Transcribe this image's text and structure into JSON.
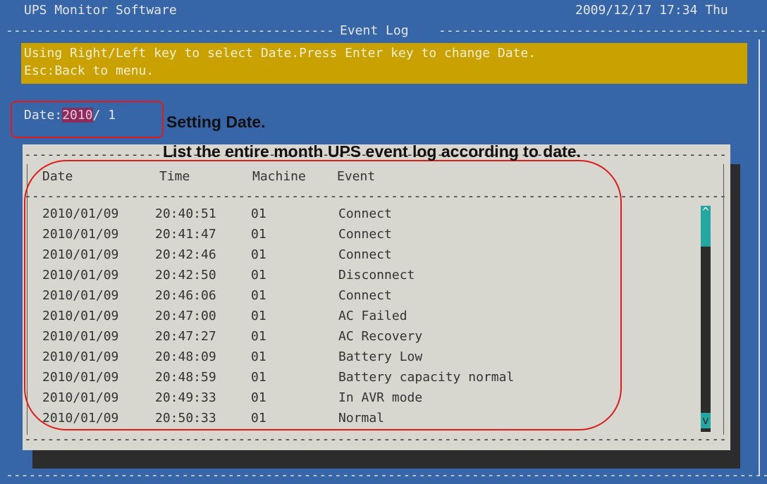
{
  "header": {
    "app_title": "UPS Monitor Software",
    "datetime": "2009/12/17 17:34 Thu",
    "section_title": "Event Log"
  },
  "help": {
    "line1": "Using Right/Left key to select Date.Press Enter key to change Date.",
    "line2": "Esc:Back to menu."
  },
  "date_selector": {
    "label": "Date:",
    "year": "2010",
    "month": "/ 1"
  },
  "annotations": {
    "setting_date": "Setting Date.",
    "list_desc": "List the entire month UPS event log according to date."
  },
  "table": {
    "columns": [
      "Date",
      "Time",
      "Machine",
      "Event"
    ],
    "rows": [
      [
        "2010/01/09",
        "20:40:51",
        "01",
        "Connect"
      ],
      [
        "2010/01/09",
        "20:41:47",
        "01",
        "Connect"
      ],
      [
        "2010/01/09",
        "20:42:46",
        "01",
        "Connect"
      ],
      [
        "2010/01/09",
        "20:42:50",
        "01",
        "Disconnect"
      ],
      [
        "2010/01/09",
        "20:46:06",
        "01",
        "Connect"
      ],
      [
        "2010/01/09",
        "20:47:00",
        "01",
        "AC Failed"
      ],
      [
        "2010/01/09",
        "20:47:27",
        "01",
        "AC Recovery"
      ],
      [
        "2010/01/09",
        "20:48:09",
        "01",
        "Battery Low"
      ],
      [
        "2010/01/09",
        "20:48:59",
        "01",
        "Battery capacity normal"
      ],
      [
        "2010/01/09",
        "20:49:33",
        "01",
        "In AVR mode"
      ],
      [
        "2010/01/09",
        "20:50:33",
        "01",
        "Normal"
      ]
    ]
  },
  "scrollbar": {
    "up_glyph": "^",
    "down_glyph": "v"
  },
  "colors": {
    "background": "#3766a8",
    "help_bar": "#c9a100",
    "panel": "#d7d7cf",
    "scroll_thumb": "#24a7a0",
    "annotation_outline": "#e01b1b",
    "date_highlight": "#8a2d5c"
  }
}
